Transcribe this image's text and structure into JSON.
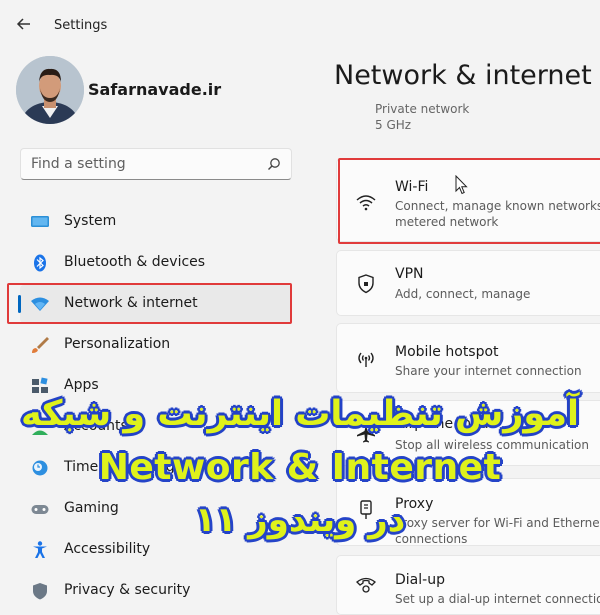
{
  "window": {
    "title": "Settings"
  },
  "user": {
    "name": "Safarnavade.ir"
  },
  "search": {
    "placeholder": "Find a setting"
  },
  "sidebar": {
    "items": [
      {
        "label": "System",
        "icon": "display-icon"
      },
      {
        "label": "Bluetooth & devices",
        "icon": "bluetooth-icon"
      },
      {
        "label": "Network & internet",
        "icon": "wifi-icon",
        "active": true
      },
      {
        "label": "Personalization",
        "icon": "brush-icon"
      },
      {
        "label": "Apps",
        "icon": "apps-icon"
      },
      {
        "label": "Accounts",
        "icon": "person-icon"
      },
      {
        "label": "Time & language",
        "icon": "clock-globe-icon"
      },
      {
        "label": "Gaming",
        "icon": "gamepad-icon"
      },
      {
        "label": "Accessibility",
        "icon": "accessibility-icon"
      },
      {
        "label": "Privacy & security",
        "icon": "shield-icon"
      }
    ]
  },
  "main": {
    "title": "Network & internet",
    "faded_lines": [
      "Private network",
      "5 GHz"
    ],
    "cards": [
      {
        "title": "Wi-Fi",
        "subtitle": "Connect, manage known networks, metered network",
        "icon": "wifi-icon"
      },
      {
        "title": "VPN",
        "subtitle": "Add, connect, manage",
        "icon": "shield-icon"
      },
      {
        "title": "Mobile hotspot",
        "subtitle": "Share your internet connection",
        "icon": "hotspot-icon"
      },
      {
        "title": "Airplane mode",
        "subtitle": "Stop all wireless communication",
        "icon": "airplane-icon"
      },
      {
        "title": "Proxy",
        "subtitle": "Proxy server for Wi-Fi and Ethernet connections",
        "icon": "proxy-icon"
      },
      {
        "title": "Dial-up",
        "subtitle": "Set up a dial-up internet connection",
        "icon": "dialup-icon"
      }
    ]
  },
  "overlay": {
    "line1": "آموزش تنظیمات اینترنت و شبکه",
    "line2": "Network & Internet",
    "line3": "در ویندوز ۱۱"
  },
  "colors": {
    "accent": "#0067c0",
    "highlight_box": "#e03a3a",
    "overlay_text": "#dff21b",
    "overlay_outline": "#2544c8"
  }
}
